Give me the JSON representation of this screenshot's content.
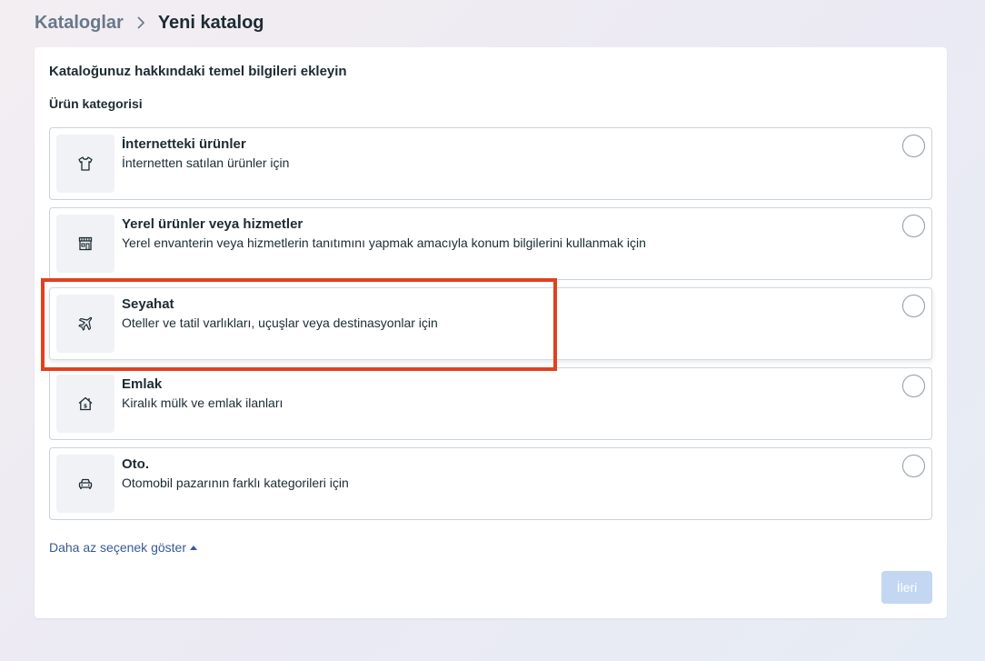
{
  "breadcrumb": {
    "parent": "Kataloglar",
    "current": "Yeni katalog"
  },
  "card": {
    "title": "Kataloğunuz hakkındaki temel bilgileri ekleyin",
    "section_label": "Ürün kategorisi"
  },
  "options": [
    {
      "icon": "tshirt-icon",
      "title": "İnternetteki ürünler",
      "desc": "İnternetten satılan ürünler için"
    },
    {
      "icon": "storefront-icon",
      "title": "Yerel ürünler veya hizmetler",
      "desc": "Yerel envanterin veya hizmetlerin tanıtımını yapmak amacıyla konum bilgilerini kullanmak için"
    },
    {
      "icon": "airplane-icon",
      "title": "Seyahat",
      "desc": "Oteller ve tatil varlıkları, uçuşlar veya destinasyonlar için"
    },
    {
      "icon": "house-icon",
      "title": "Emlak",
      "desc": "Kiralık mülk ve emlak ilanları"
    },
    {
      "icon": "car-icon",
      "title": "Oto.",
      "desc": "Otomobil pazarının farklı kategorileri için"
    }
  ],
  "show_less_label": "Daha az seçenek göster",
  "next_label": "İleri",
  "colors": {
    "highlight": "#e0411e",
    "link": "#385898",
    "button_disabled": "#c3d7f2"
  }
}
